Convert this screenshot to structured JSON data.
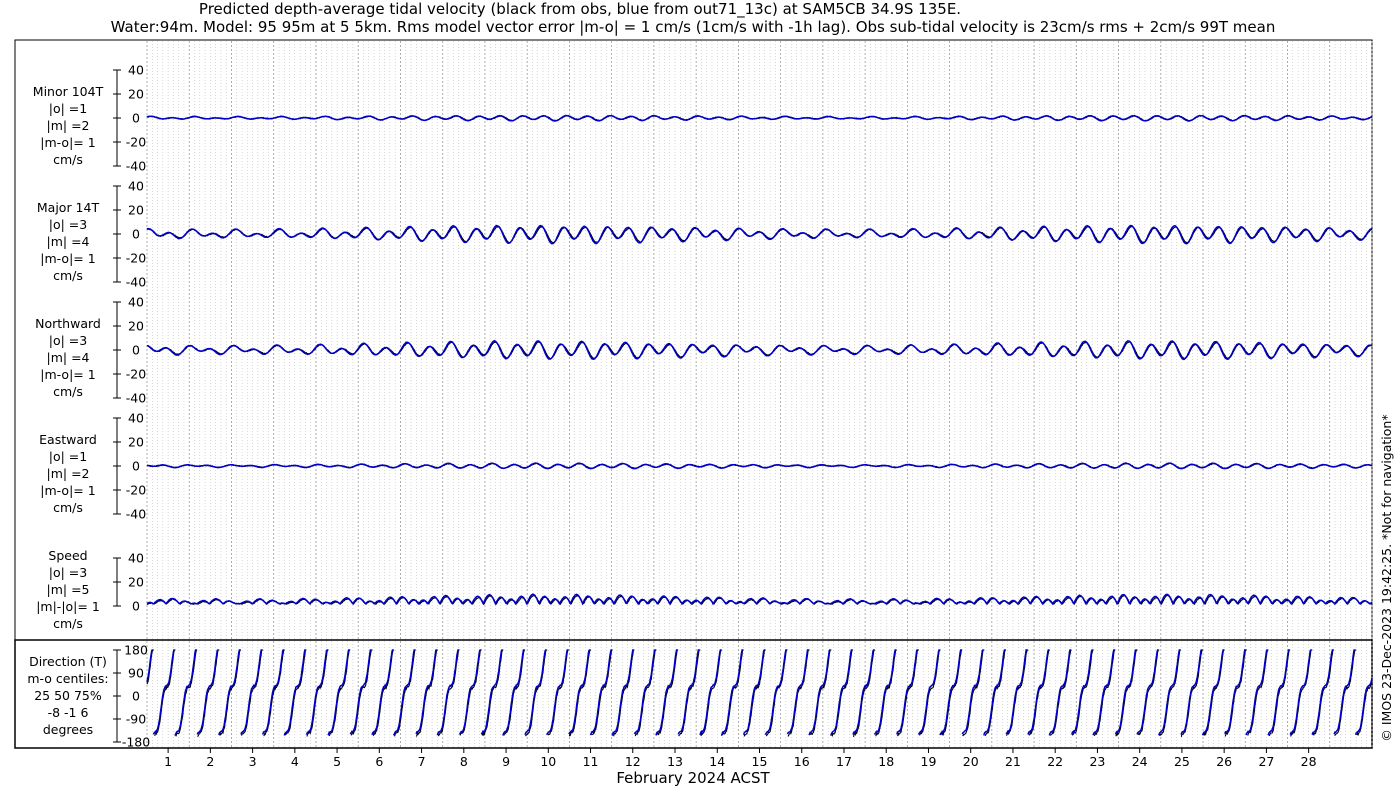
{
  "header": {
    "title_line1": "Predicted depth-average tidal velocity (black from obs, blue from out71_13c) at SAM5CB 34.9S 135E.",
    "title_line2": "Water:94m. Model: 95 95m at 5 5km. Rms model vector error |m-o| = 1 cm/s (1cm/s with -1h lag). Obs sub-tidal velocity is 23cm/s rms + 2cm/s 99T mean"
  },
  "colors": {
    "obs": "#000000",
    "model": "#0000cc",
    "grid": "#b0b0b0"
  },
  "chart_data": {
    "type": "line",
    "xlabel": "February 2024 ACST",
    "x_ticks": [
      "1",
      "2",
      "3",
      "4",
      "5",
      "6",
      "7",
      "8",
      "9",
      "10",
      "11",
      "12",
      "13",
      "14",
      "15",
      "16",
      "17",
      "18",
      "19",
      "20",
      "21",
      "22",
      "23",
      "24",
      "25",
      "26",
      "27",
      "28"
    ],
    "xlim_days": [
      0,
      29
    ],
    "series_names": [
      "obs",
      "out71_13c"
    ],
    "panels": [
      {
        "name": "minor",
        "label_lines": [
          "Minor 104T",
          "|o| =1",
          "|m| =2",
          "|m-o|= 1",
          "cm/s"
        ],
        "ylim": [
          -40,
          40
        ],
        "yticks": [
          "40",
          "20",
          "0",
          "-20",
          "-40"
        ],
        "amplitude": 1.5,
        "kind": "signed"
      },
      {
        "name": "major",
        "label_lines": [
          "Major 14T",
          "|o| =3",
          "|m| =4",
          "|m-o|= 1",
          "cm/s"
        ],
        "ylim": [
          -40,
          40
        ],
        "yticks": [
          "40",
          "20",
          "0",
          "-20",
          "-40"
        ],
        "amplitude": 5,
        "kind": "signed"
      },
      {
        "name": "northward",
        "label_lines": [
          "Northward",
          "|o| =3",
          "|m| =4",
          "|m-o|= 1",
          "cm/s"
        ],
        "ylim": [
          -40,
          40
        ],
        "yticks": [
          "40",
          "20",
          "0",
          "-20",
          "-40"
        ],
        "amplitude": 5,
        "kind": "signed"
      },
      {
        "name": "eastward",
        "label_lines": [
          "Eastward",
          "|o| =1",
          "|m| =2",
          "|m-o|= 1",
          "cm/s"
        ],
        "ylim": [
          -40,
          40
        ],
        "yticks": [
          "40",
          "20",
          "0",
          "-20",
          "-40"
        ],
        "amplitude": 1.5,
        "kind": "signed"
      },
      {
        "name": "speed",
        "label_lines": [
          "Speed",
          "|o| =3",
          "|m| =5",
          "|m|-|o|= 1",
          "cm/s"
        ],
        "ylim": [
          0,
          40
        ],
        "yticks": [
          "40",
          "20",
          "0"
        ],
        "amplitude": 5,
        "kind": "speed"
      },
      {
        "name": "direction",
        "label_lines": [
          "Direction (T)",
          "m-o centiles:",
          "25  50  75%",
          "-8 -1  6",
          "degrees"
        ],
        "ylim": [
          -180,
          180
        ],
        "yticks": [
          "180",
          "90",
          "0",
          "-90",
          "-180"
        ],
        "kind": "direction"
      }
    ]
  },
  "side_note": "© IMOS 23-Dec-2023 19:42:25. *Not for navigation*"
}
